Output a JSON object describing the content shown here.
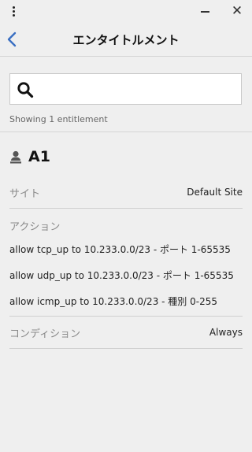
{
  "header": {
    "title": "エンタイトルメント",
    "menu_icon": "kebab-menu-icon",
    "back_icon": "chevron-left-icon",
    "minimize_icon": "minimize-icon",
    "close_icon": "close-icon",
    "close_glyph": "✕"
  },
  "search": {
    "value": "",
    "placeholder": "",
    "icon": "search-icon"
  },
  "results": {
    "count_text": "Showing 1 entitlement"
  },
  "entitlement": {
    "icon": "user-icon",
    "name": "A1",
    "site": {
      "label": "サイト",
      "value": "Default Site"
    },
    "actions": {
      "label": "アクション",
      "items": [
        "allow tcp_up to 10.233.0.0/23 - ポート 1-65535",
        "allow udp_up to 10.233.0.0/23 - ポート 1-65535",
        "allow icmp_up to 10.233.0.0/23 - 種別 0-255"
      ]
    },
    "condition": {
      "label": "コンディション",
      "value": "Always"
    }
  },
  "colors": {
    "background": "#efefef",
    "accent": "#3a6fc2",
    "divider": "#d4d4d4",
    "label": "#8a8a8a"
  }
}
